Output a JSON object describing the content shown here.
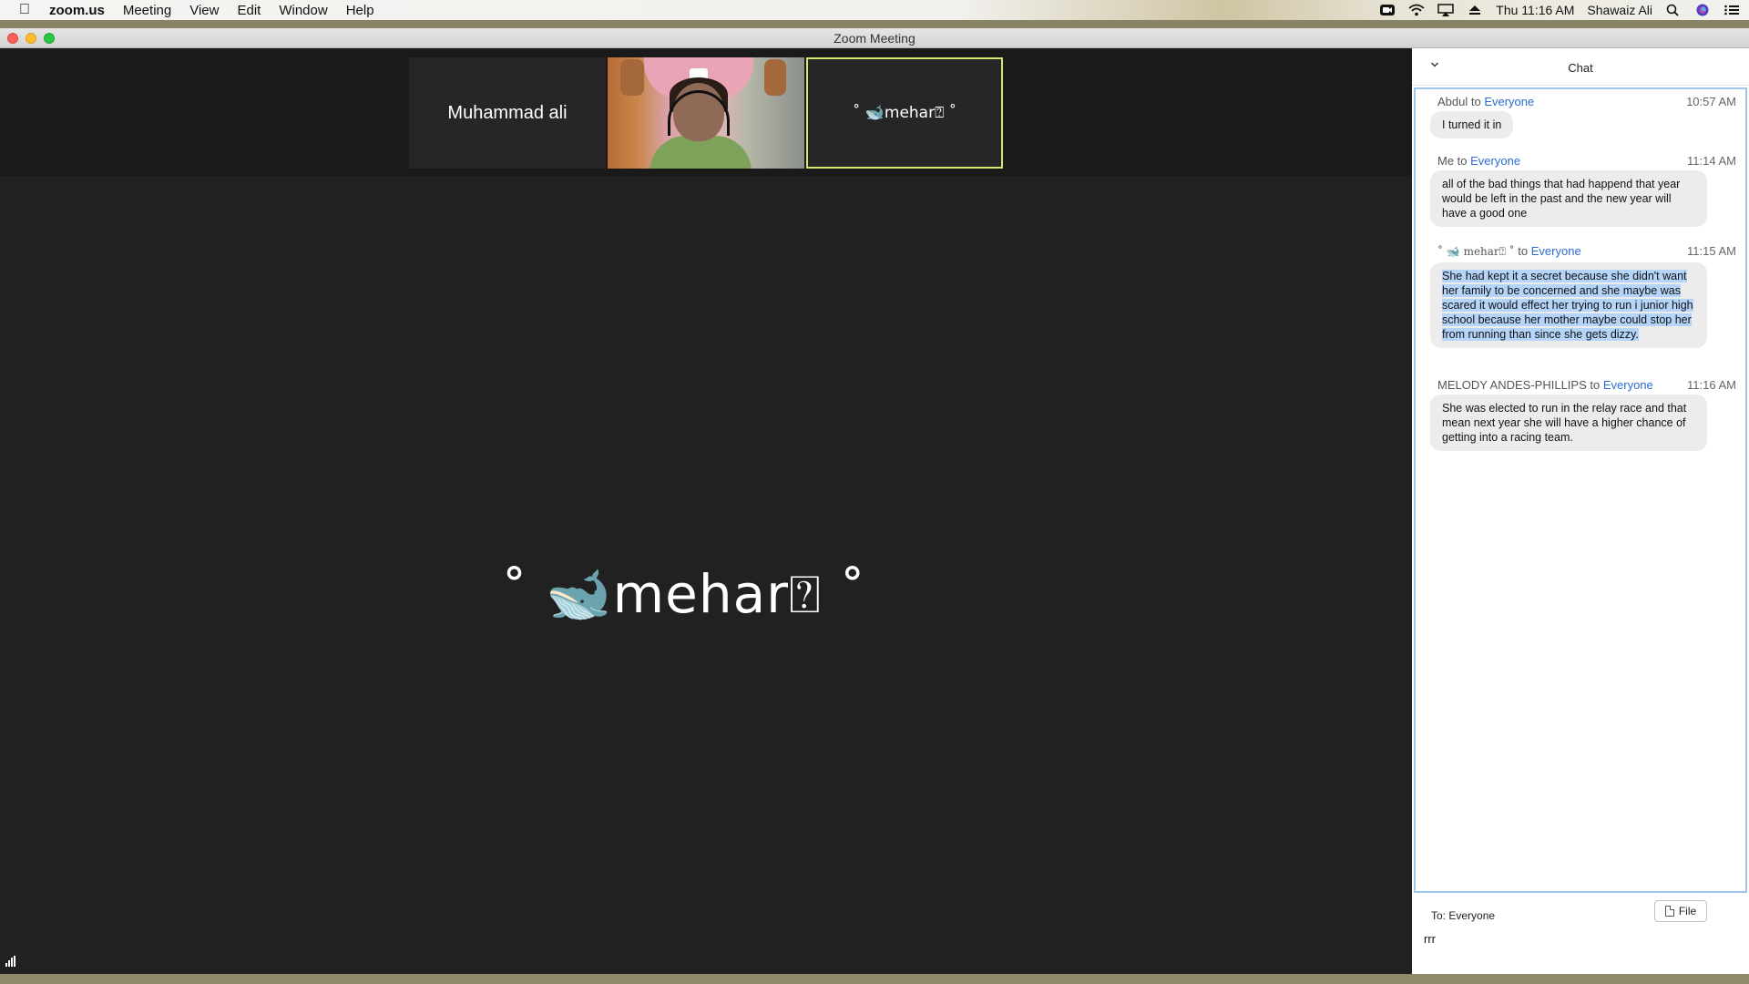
{
  "menubar": {
    "app_name": "zoom.us",
    "menus": [
      "Meeting",
      "View",
      "Edit",
      "Window",
      "Help"
    ],
    "clock": "Thu 11:16 AM",
    "user": "Shawaiz Ali",
    "status_icons": [
      "zoom-status-icon",
      "wifi-icon",
      "airplay-icon",
      "eject-icon",
      "search-icon",
      "siri-icon",
      "notification-center-icon"
    ]
  },
  "window": {
    "title": "Zoom Meeting"
  },
  "thumbnails": [
    {
      "name": "Muhammad ali",
      "video": false
    },
    {
      "name": "",
      "video": true
    },
    {
      "name": "˚ 🐋mehar⍰ ˚",
      "video": false,
      "active": true
    }
  ],
  "active_speaker": {
    "name": "˚ 🐋mehar⍰ ˚"
  },
  "chat": {
    "title": "Chat",
    "messages": [
      {
        "sender": "Abdul",
        "to_word": " to ",
        "recipient": "Everyone",
        "time": "10:57 AM",
        "text": "I turned it in"
      },
      {
        "sender": "Me",
        "to_word": " to ",
        "recipient": "Everyone",
        "time": "11:14 AM",
        "text": "all of the bad things that had happend that year would be left in the past and the new year will have a good one"
      },
      {
        "sender": "˚ 🐋 mehar⍰ ˚",
        "to_word": " to ",
        "recipient": "Everyone",
        "time": "11:15 AM",
        "text": "She had kept it a secret because she didn't want her family to be concerned and she maybe was scared it would effect her trying to run i junior high school because her mother maybe could stop her from running than since she gets dizzy."
      },
      {
        "sender": "MELODY ANDES-PHILLIPS",
        "to_word": " to ",
        "recipient": "Everyone",
        "time": "11:16 AM",
        "text": "She was elected to run in the relay race and that mean next year she will have a higher chance of getting into a racing team."
      }
    ],
    "compose": {
      "to_label": "To: Everyone",
      "file_label": "File",
      "input_value": "rrr"
    }
  }
}
